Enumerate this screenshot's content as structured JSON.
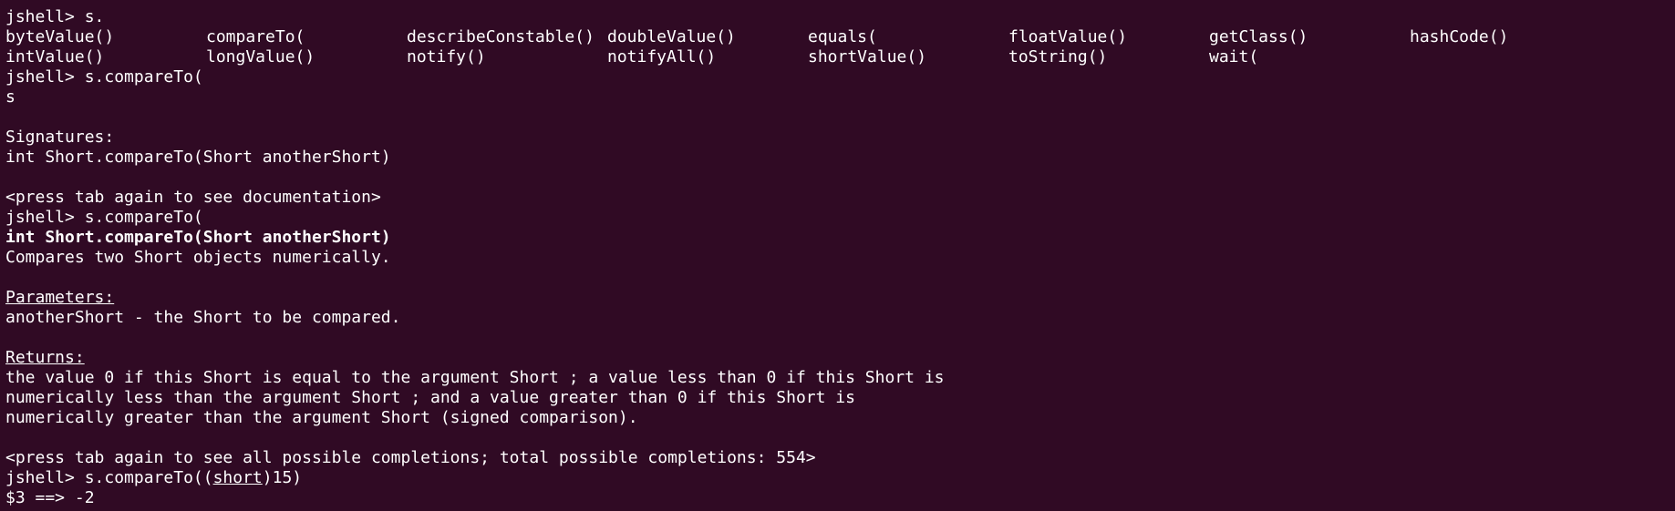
{
  "window": {
    "background": "#300a24",
    "foreground": "#ffffff"
  },
  "terminal": {
    "line1_prompt": "jshell> s.",
    "completions_row1": [
      "byteValue()",
      "compareTo(",
      "describeConstable()",
      "doubleValue()",
      "equals(",
      "floatValue()",
      "getClass()",
      "hashCode()"
    ],
    "completions_row2": [
      "intValue()",
      "longValue()",
      "notify()",
      "notifyAll()",
      "shortValue()",
      "toString()",
      "wait("
    ],
    "line4_prompt": "jshell> s.compareTo(",
    "line5_echo": "s",
    "signatures_header": "Signatures:",
    "signature": "int Short.compareTo(Short anotherShort)",
    "doc_hint": "<press tab again to see documentation>",
    "line10_prompt": "jshell> s.compareTo(",
    "doc_signature": "int Short.compareTo(Short anotherShort)",
    "doc_summary": "Compares two Short objects numerically.",
    "params_header": "Parameters:",
    "params_text": "anotherShort - the Short to be compared.",
    "returns_header": "Returns:",
    "returns_line1": "the value 0 if this Short is equal to the argument Short ; a value less than 0 if this Short is",
    "returns_line2": "numerically less than the argument Short ; and a value greater than 0 if this Short is",
    "returns_line3": "numerically greater than the argument Short (signed comparison).",
    "completions_hint": "<press tab again to see all possible completions; total possible completions: 554>",
    "final_prompt_prefix": "jshell> s.compareTo((",
    "final_prompt_cast": "short",
    "final_prompt_suffix": ")15)",
    "result": "$3 ==> -2"
  }
}
